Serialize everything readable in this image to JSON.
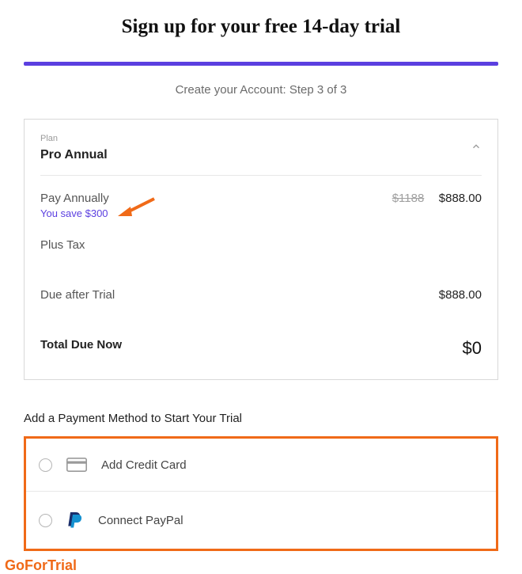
{
  "header": {
    "title": "Sign up for your free 14-day trial",
    "step_label": "Create your Account: Step 3 of 3"
  },
  "plan": {
    "label": "Plan",
    "name": "Pro Annual",
    "pay_annually_label": "Pay Annually",
    "save_note": "You save $300",
    "original_price": "$1188",
    "discount_price": "$888.00",
    "plus_tax_label": "Plus Tax",
    "due_after_label": "Due after Trial",
    "due_after_value": "$888.00",
    "total_label": "Total Due Now",
    "total_value": "$0"
  },
  "payment": {
    "section_label": "Add a Payment Method to Start Your Trial",
    "credit_card_label": "Add Credit Card",
    "paypal_label": "Connect PayPal"
  },
  "watermark": "GoForTrial",
  "colors": {
    "accent": "#5b3fe0",
    "highlight": "#f06a18"
  }
}
